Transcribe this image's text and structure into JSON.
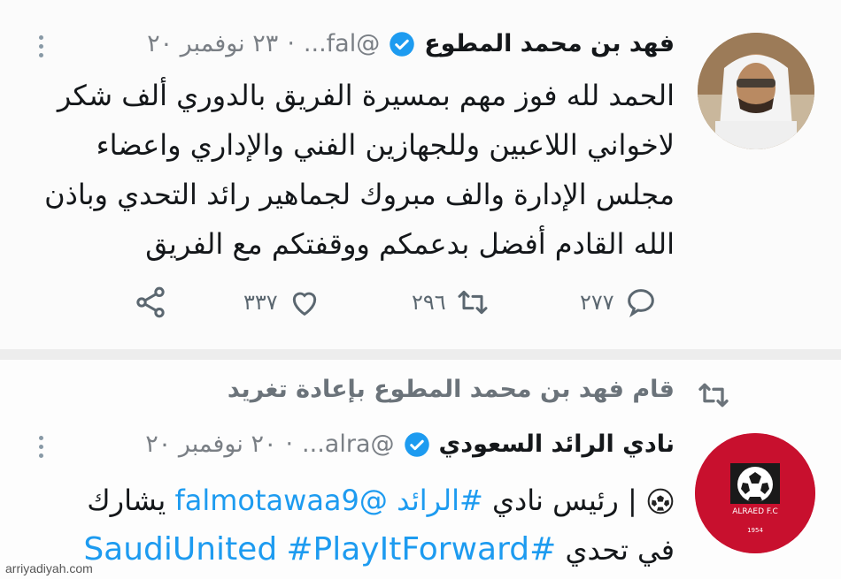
{
  "tweet1": {
    "author_name": "فهد بن محمد المطوع",
    "handle": "@fal...",
    "dot": "·",
    "date": "٢٣ نوفمبر ٢٠",
    "text": "الحمد لله فوز مهم بمسيرة الفريق بالدوري ألف شكر لاخواني اللاعبين وللجهازين الفني والإداري واعضاء مجلس الإدارة والف مبروك لجماهير رائد التحدي وباذن الله القادم أفضل بدعمكم ووقفتكم مع الفريق",
    "actions": {
      "reply_count": "٢٧٧",
      "retweet_count": "٢٩٦",
      "like_count": "٣٣٧"
    }
  },
  "retweet_banner": {
    "text": "قام فهد بن محمد المطوع بإعادة تغريد"
  },
  "tweet2": {
    "author_name": "نادي الرائد السعودي",
    "handle": "@alra...",
    "dot": "·",
    "date": "٢٠ نوفمبر ٢٠",
    "line1_a": "| رئيس نادي",
    "line1_hashtag": "#الرائد",
    "line1_mention": "@falmotawaa9",
    "line1_b": "يشارك",
    "line2_a": "في تحدي",
    "line2_hashtag1": "#SaudiUnited",
    "line2_hashtag2": "#PlayItForward",
    "logo_text": "ALRAED F.C",
    "logo_year": "1954"
  },
  "watermark": "arriyadiyah.com",
  "colors": {
    "link": "#1d9bf0",
    "verified": "#1d9bf0",
    "club_red": "#c8102e"
  }
}
